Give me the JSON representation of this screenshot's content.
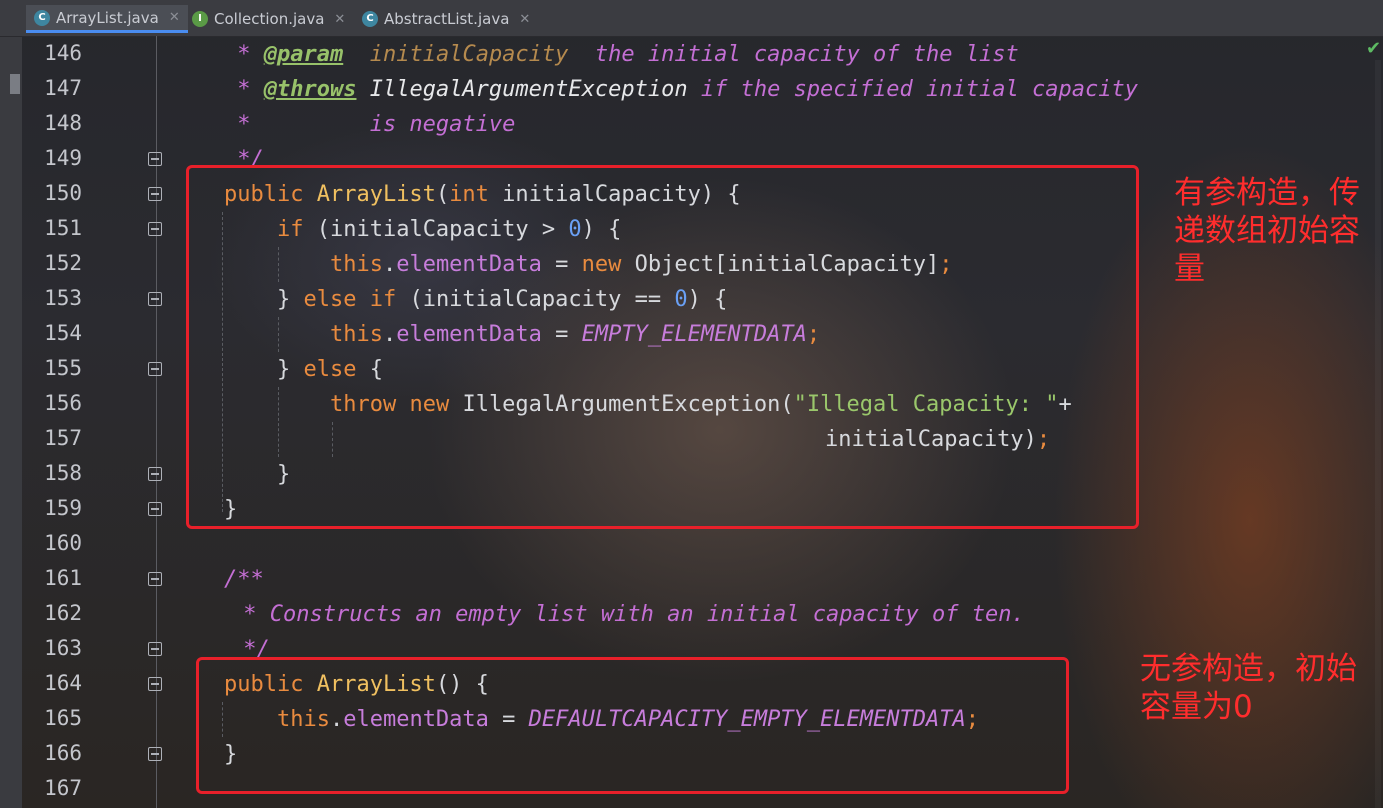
{
  "tabs": [
    {
      "icon": "C",
      "label": "ArrayList.java",
      "active": true
    },
    {
      "icon": "I",
      "label": "Collection.java",
      "active": false
    },
    {
      "icon": "C",
      "label": "AbstractList.java",
      "active": false
    }
  ],
  "close_glyph": "✕",
  "line_numbers": [
    "146",
    "147",
    "148",
    "149",
    "150",
    "151",
    "152",
    "153",
    "154",
    "155",
    "156",
    "157",
    "158",
    "159",
    "160",
    "161",
    "162",
    "163",
    "164",
    "165",
    "166",
    "167"
  ],
  "code": {
    "l146": {
      "star": " * ",
      "tag": "@param",
      "mid": "  ",
      "param": "initialCapacity",
      "rest": "  the initial capacity of the list"
    },
    "l147": {
      "star": " * ",
      "tag": "@throws",
      "mid": " ",
      "exc": "IllegalArgumentException",
      "rest": " if the specified initial capacity"
    },
    "l148": {
      "text": " *         is negative"
    },
    "l149": {
      "text": " */"
    },
    "l150": {
      "kw": "public ",
      "name": "ArrayList",
      "open": "(",
      "type": "int",
      "rest": " initialCapacity) {"
    },
    "l151": {
      "indent": "    ",
      "kw": "if",
      "rest1": " (initialCapacity > ",
      "num": "0",
      "rest2": ") {"
    },
    "l152": {
      "indent": "        ",
      "kw": "this",
      "dot": ".",
      "field": "elementData",
      "mid": " = ",
      "kw2": "new",
      "rest": " Object[initialCapacity]",
      ",semi": ";"
    },
    "l153": {
      "indent": "    ",
      "p1": "} ",
      "kw": "else if",
      "rest1": " (initialCapacity == ",
      "num": "0",
      "rest2": ") {"
    },
    "l154": {
      "indent": "        ",
      "kw": "this",
      "dot": ".",
      "field": "elementData",
      "mid": " = ",
      "cst": "EMPTY_ELEMENTDATA",
      "semi": ";"
    },
    "l155": {
      "indent": "    ",
      "p1": "} ",
      "kw": "else",
      "rest": " {"
    },
    "l156": {
      "indent": "        ",
      "kw": "throw",
      "sp": " ",
      "kw2": "new",
      "rest": " IllegalArgumentException(",
      "str": "\"Illegal Capacity: \"",
      "plus": "+"
    },
    "l157": {
      "rest": "initialCapacity)",
      "semi": ";"
    },
    "l158": {
      "text": "    }"
    },
    "l159": {
      "text": "}"
    },
    "l161": {
      "text": "/**"
    },
    "l162": {
      "text": " * Constructs an empty list with an initial capacity of ten."
    },
    "l163": {
      "text": " */"
    },
    "l164": {
      "kw": "public ",
      "name": "ArrayList",
      "rest": "() {"
    },
    "l165": {
      "indent": "    ",
      "kw": "this",
      "dot": ".",
      "field": "elementData",
      "mid": " = ",
      "cst": "DEFAULTCAPACITY_EMPTY_ELEMENTDATA",
      "semi": ";"
    },
    "l166": {
      "text": "}"
    }
  },
  "annotations": {
    "note1": [
      "有参构造，传",
      "递数组初始容",
      "量"
    ],
    "note2": [
      "无参构造，初始",
      "容量为0"
    ]
  }
}
